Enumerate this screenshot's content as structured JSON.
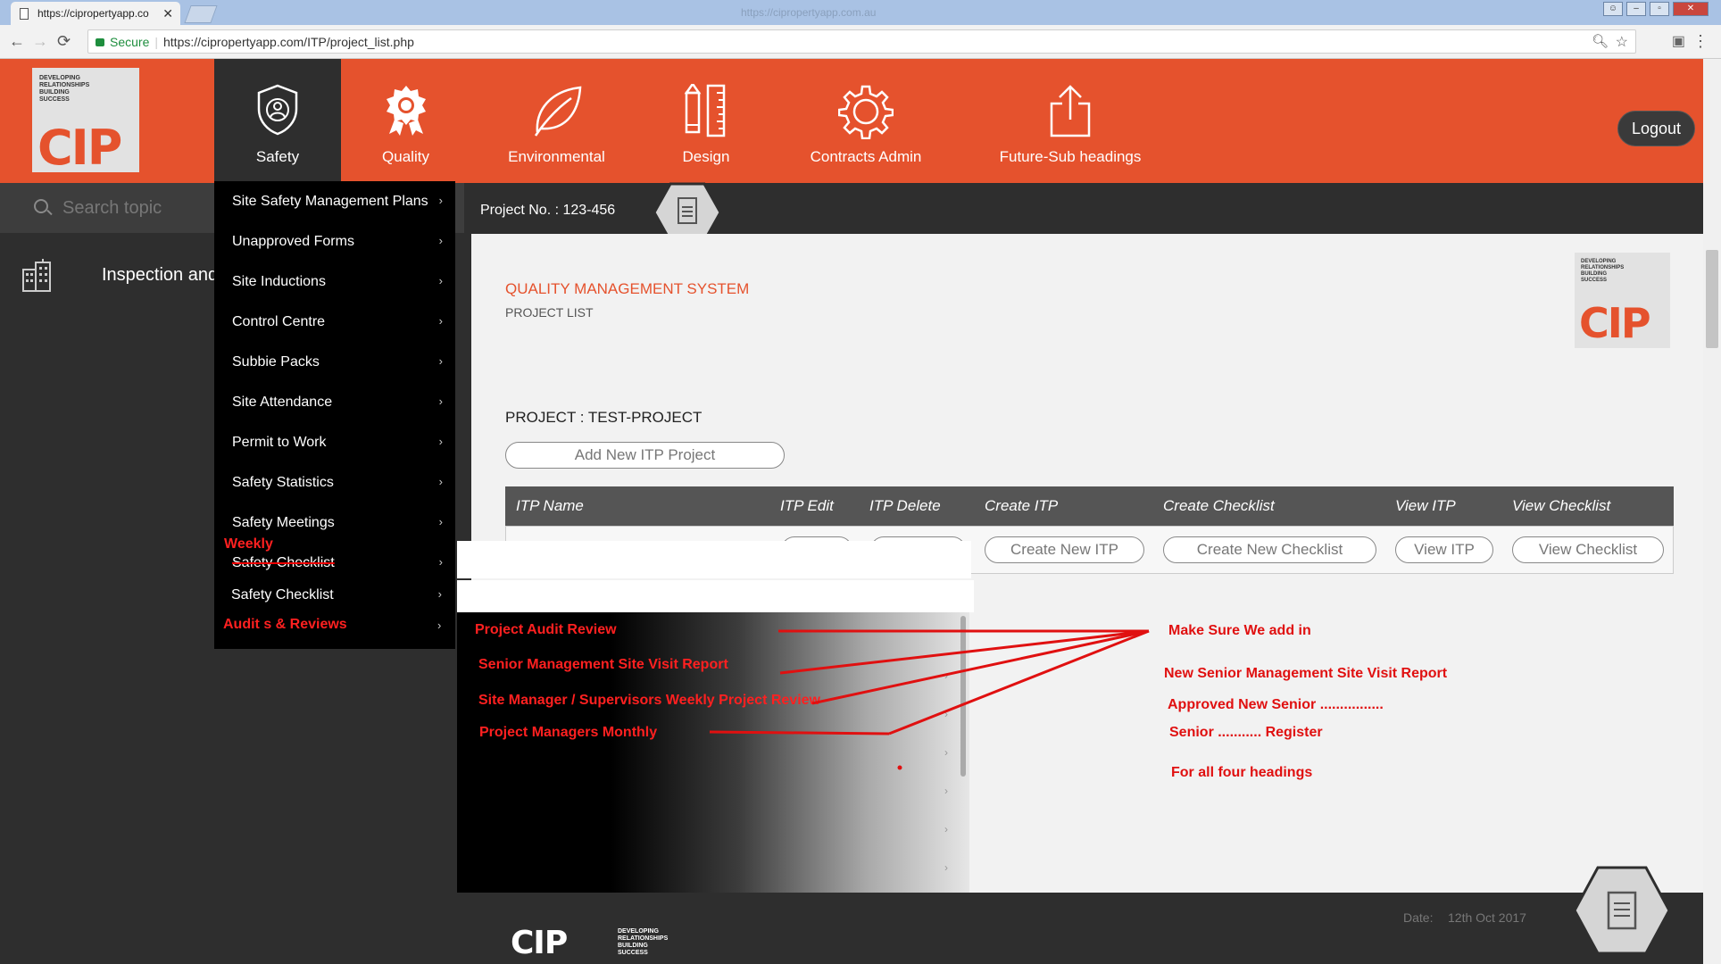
{
  "browser": {
    "tab_title": "https://cipropertyapp.co",
    "tab_close": "✕",
    "window_title": "https://cipropertyapp.com.au",
    "secure_label": "Secure",
    "url": "https://cipropertyapp.com/ITP/project_list.php"
  },
  "logo": {
    "tagline": "DEVELOPING RELATIONSHIPS BUILDING SUCCESS",
    "name": "CIP"
  },
  "nav": {
    "items": [
      {
        "label": "Safety",
        "icon": "shield-user-icon"
      },
      {
        "label": "Quality",
        "icon": "award-icon"
      },
      {
        "label": "Environmental",
        "icon": "leaf-icon"
      },
      {
        "label": "Design",
        "icon": "pencil-ruler-icon"
      },
      {
        "label": "Contracts Admin",
        "icon": "gear-icon"
      },
      {
        "label": "Future-Sub headings",
        "icon": "share-icon"
      }
    ],
    "logout": "Logout"
  },
  "sidebar": {
    "search_placeholder": "Search topic",
    "item_label": "Inspection and"
  },
  "safety_menu": {
    "items": [
      "Site Safety Management Plans",
      "Unapproved Forms",
      "Site Inductions",
      "Control Centre",
      "Subbie Packs",
      "Site Attendance",
      "Permit to Work",
      "Safety Statistics",
      "Safety Meetings"
    ],
    "weekly_note": "Weekly",
    "struck_item": "Safety Checklist",
    "safety_checklist": "Safety Checklist",
    "audits": "Audit s &  Reviews",
    "arrow": "›"
  },
  "project": {
    "number_label": "Project No. : 123-456",
    "system_title": "QUALITY MANAGEMENT SYSTEM",
    "subtitle": "PROJECT LIST",
    "project_label": "PROJECT : TEST-PROJECT",
    "add_button": "Add New ITP Project"
  },
  "table": {
    "headers": [
      "ITP Name",
      "ITP Edit",
      "ITP Delete",
      "Create ITP",
      "Create Checklist",
      "View ITP",
      "View Checklist"
    ],
    "row_buttons": [
      "Create New ITP",
      "Create New Checklist",
      "View ITP",
      "View Checklist"
    ]
  },
  "audit_submenu": {
    "items": [
      "Project Audit Review",
      "Senior Management Site Visit Report",
      "Site Manager / Supervisors Weekly Project Review",
      "Project Managers Monthly"
    ]
  },
  "annotations": {
    "line1": "Make Sure We add in",
    "line2": "New Senior Management Site Visit Report",
    "line3": "Approved New Senior ................",
    "line4": "Senior ........... Register",
    "line5": "For all four headings"
  },
  "footer": {
    "date_label": "Date:",
    "date_value": "12th Oct 2017"
  },
  "colors": {
    "brand": "#e5522d",
    "dark": "#2e2e2e",
    "annotation_red": "#ff2020"
  }
}
